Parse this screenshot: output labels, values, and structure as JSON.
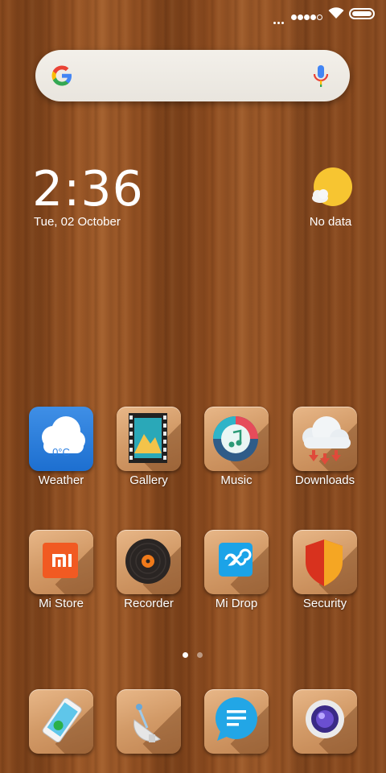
{
  "status_bar": {
    "signal_icon": "signal-icon",
    "wifi_icon": "wifi-icon",
    "battery_icon": "battery-icon"
  },
  "search": {
    "logo_icon": "google-g-icon",
    "mic_icon": "mic-icon"
  },
  "clock": {
    "time": "2:36",
    "date": "Tue, 02 October"
  },
  "weather_widget": {
    "icon": "sun-cloud-icon",
    "text": "No data"
  },
  "apps": [
    {
      "label": "Weather",
      "icon": "weather-cloud-icon",
      "temp": "0°C"
    },
    {
      "label": "Gallery",
      "icon": "film-gallery-icon"
    },
    {
      "label": "Music",
      "icon": "music-icon"
    },
    {
      "label": "Downloads",
      "icon": "download-cloud-icon"
    },
    {
      "label": "Mi Store",
      "icon": "mi-store-icon"
    },
    {
      "label": "Recorder",
      "icon": "recorder-icon"
    },
    {
      "label": "Mi Drop",
      "icon": "mi-drop-icon"
    },
    {
      "label": "Security",
      "icon": "shield-icon"
    }
  ],
  "dock": [
    {
      "icon": "phone-icon"
    },
    {
      "icon": "satellite-dish-icon"
    },
    {
      "icon": "messages-icon"
    },
    {
      "icon": "camera-icon"
    }
  ],
  "pages": {
    "count": 2,
    "active": 1
  },
  "colors": {
    "accent_weather": "#2a7ee0",
    "mi_orange": "#f15a22",
    "security_red": "#d8321e"
  }
}
